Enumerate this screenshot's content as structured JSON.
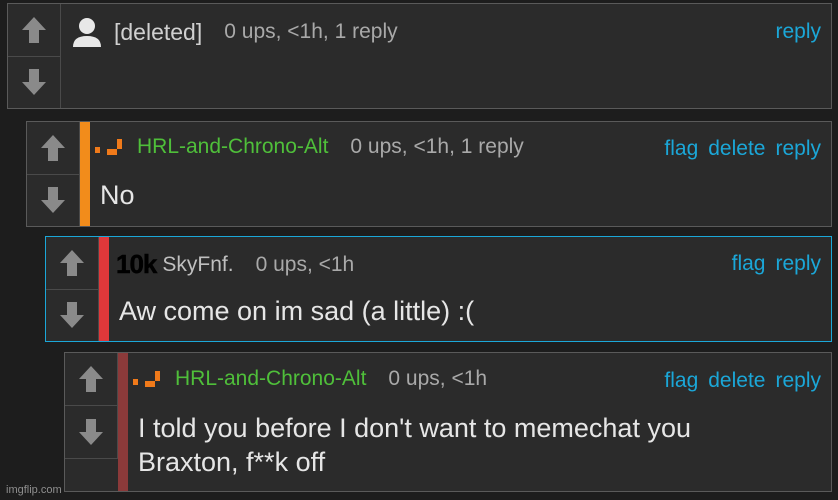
{
  "comments": [
    {
      "username": "[deleted]",
      "meta": "0 ups, <1h, 1 reply",
      "actions": [
        "reply"
      ],
      "text": ""
    },
    {
      "username": "HRL-and-Chrono-Alt",
      "meta": "0 ups, <1h, 1 reply",
      "actions": [
        "flag",
        "delete",
        "reply"
      ],
      "text": "No",
      "stripe_color": "#f28c1b"
    },
    {
      "badge": "10k",
      "username": "SkyFnf.",
      "meta": "0 ups, <1h",
      "actions": [
        "flag",
        "reply"
      ],
      "text": "Aw come on im sad (a little) :(",
      "stripe_color": "#e0383a"
    },
    {
      "username": "HRL-and-Chrono-Alt",
      "meta": "0 ups, <1h",
      "actions": [
        "flag",
        "delete",
        "reply"
      ],
      "text_line1": "I told you before I don't want to memechat you",
      "text_line2": "Braxton, f**k off",
      "stripe_color": "#8b3a3a"
    }
  ],
  "icons": {
    "upvote": "arrow-up-icon",
    "downvote": "arrow-down-icon",
    "avatar": "user-avatar-icon",
    "rank": "rank-bars-icon"
  },
  "colors": {
    "link": "#1ba7d8",
    "username_green": "#4fbf3a",
    "selected_border": "#1ba7d8"
  },
  "watermark": "imgflip.com"
}
